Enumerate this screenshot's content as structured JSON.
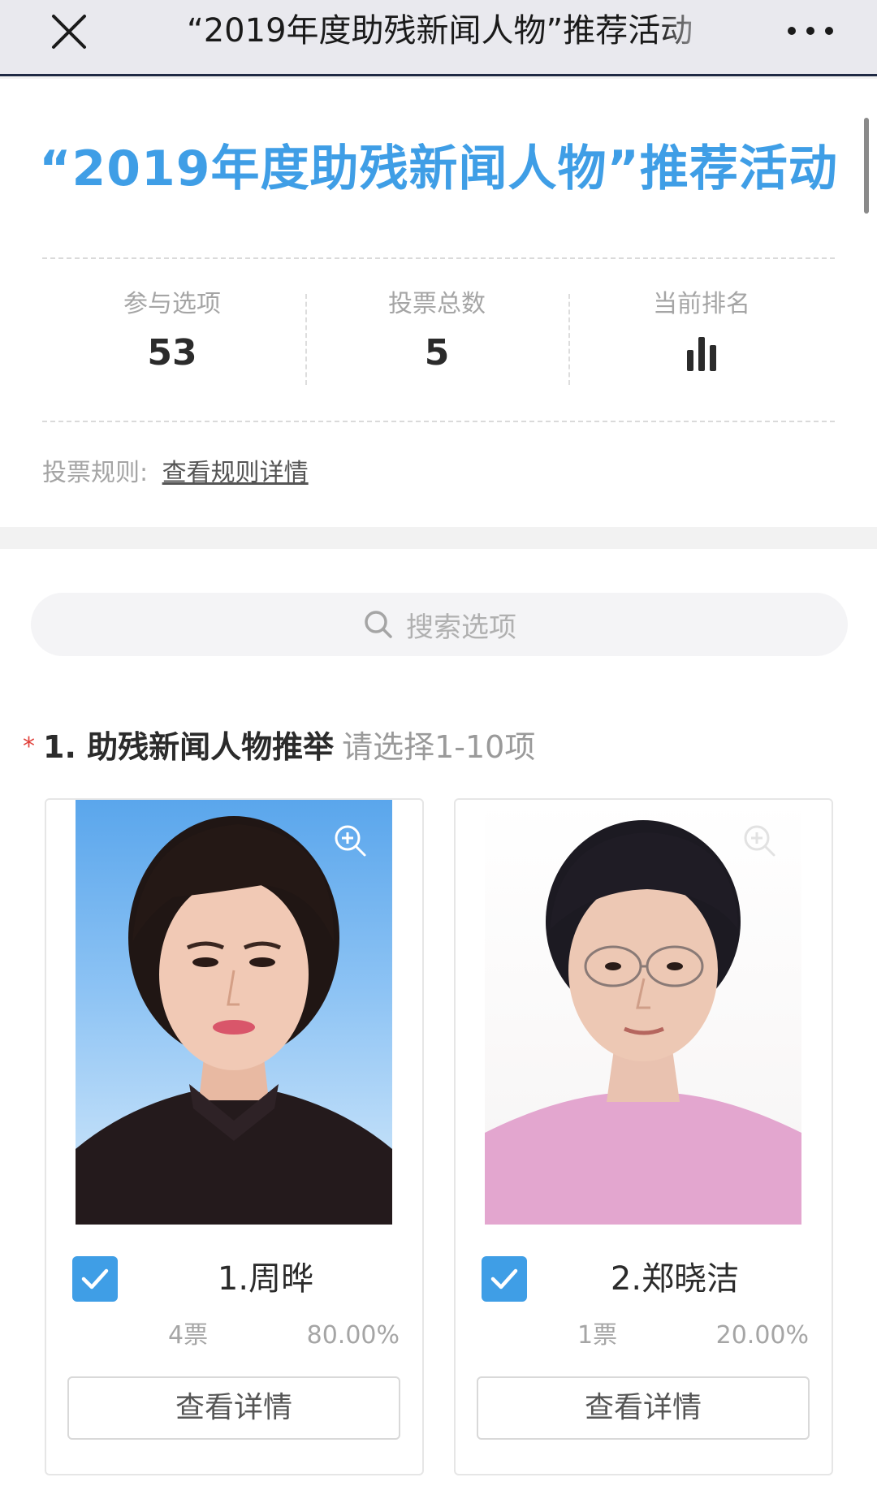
{
  "navbar": {
    "title": "“2019年度助残新闻人物”推荐活动",
    "close_icon": "close-icon",
    "more_icon": "more-icon"
  },
  "header": {
    "title": "“2019年度助残新闻人物”推荐活动",
    "title_color": "#3f9ee6",
    "stats": [
      {
        "label": "参与选项",
        "value": "53"
      },
      {
        "label": "投票总数",
        "value": "5"
      },
      {
        "label": "当前排名",
        "icon": "bar-chart-icon"
      }
    ],
    "rules_label": "投票规则:",
    "rules_link": "查看规则详情"
  },
  "search": {
    "placeholder": "搜索选项",
    "icon": "search-icon"
  },
  "question": {
    "required_mark": "*",
    "title": "1. 助残新闻人物推举",
    "hint": "请选择1-10项"
  },
  "candidates": [
    {
      "name": "1.周晔",
      "votes": "4票",
      "percent": "80.00%",
      "checked": true,
      "detail_label": "查看详情"
    },
    {
      "name": "2.郑晓洁",
      "votes": "1票",
      "percent": "20.00%",
      "checked": true,
      "detail_label": "查看详情"
    }
  ],
  "colors": {
    "accent": "#3f9ee6",
    "navbar_bg": "#e9e9ee",
    "required": "#e0403a"
  }
}
